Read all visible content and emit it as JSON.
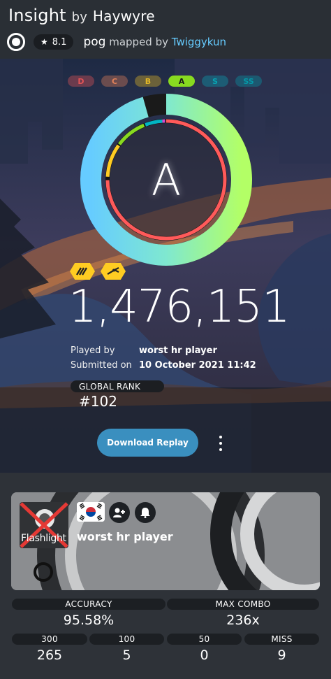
{
  "beatmap": {
    "title": "Insight",
    "by": "by",
    "artist": "Haywyre",
    "star_rating": "8.1",
    "difficulty": "pog",
    "mapped_by": "mapped by",
    "mapper": "Twiggykun"
  },
  "grades": [
    "D",
    "C",
    "B",
    "A",
    "S",
    "SS"
  ],
  "grade_colors": [
    "#ff5a5a",
    "#ff8e5d",
    "#ffcc22",
    "#88da20",
    "#02b5c3",
    "#00a8b5"
  ],
  "score": {
    "rank_letter": "A",
    "total": "1,476,151",
    "accuracy_fraction": 0.9558,
    "mods": [
      "hard-rock-icon",
      "flashlight-icon"
    ]
  },
  "info": {
    "played_by_label": "Played by",
    "played_by": "worst hr player",
    "submitted_label": "Submitted on",
    "submitted": "10 October 2021 11:42"
  },
  "global_rank": {
    "label": "GLOBAL RANK",
    "value": "#102"
  },
  "actions": {
    "download_label": "Download Replay"
  },
  "player": {
    "name": "worst hr player",
    "avatar_text": "Flashlight",
    "country_flag": "south-korea-flag"
  },
  "stats": {
    "accuracy_label": "ACCURACY",
    "accuracy": "95.58%",
    "max_combo_label": "MAX COMBO",
    "max_combo": "236x",
    "count300_label": "300",
    "count300": "265",
    "count100_label": "100",
    "count100": "5",
    "count50_label": "50",
    "count50": "0",
    "miss_label": "MISS",
    "miss": "9"
  },
  "colors": {
    "accent_blue": "#3a8fbf",
    "mapper_link": "#66ccff",
    "mod_yellow": "#ffcc22"
  }
}
